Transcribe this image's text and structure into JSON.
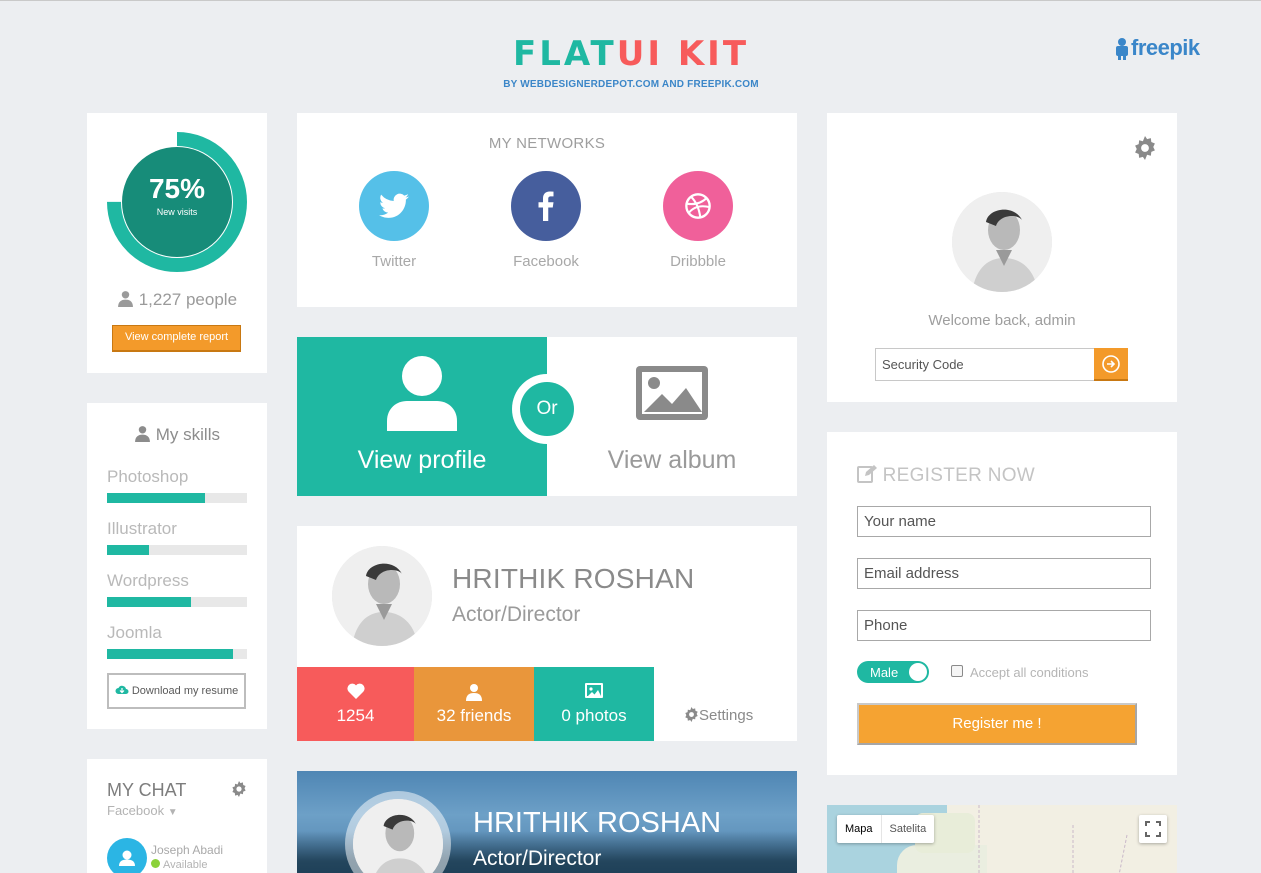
{
  "header": {
    "logo_title": "FLATUI KIT",
    "logo_subtitle": "BY WEBDESIGNERDEPOT.COM AND FREEPIK.COM",
    "freepik_label": "freepik",
    "colors": {
      "teal": "#1fb8a2",
      "red": "#f75b5b",
      "orange": "#f39a2a",
      "blue": "#3a86c9"
    }
  },
  "visits": {
    "percent_text": "75%",
    "percent_value": 75,
    "label": "New visits",
    "people": "1,227 people",
    "report_button": "View complete report"
  },
  "skills": {
    "title": "My skills",
    "items": [
      {
        "name": "Photoshop",
        "level": 0.7
      },
      {
        "name": "Illustrator",
        "level": 0.3
      },
      {
        "name": "Wordpress",
        "level": 0.6
      },
      {
        "name": "Joomla",
        "level": 0.9
      }
    ],
    "download_button": "Download my resume"
  },
  "chat": {
    "title": "MY CHAT",
    "source": "Facebook",
    "contact_name": "Joseph Abadi",
    "contact_status": "Available"
  },
  "networks": {
    "title": "MY NETWORKS",
    "items": [
      {
        "label": "Twitter",
        "icon": "twitter-icon",
        "color": "#55c0e8"
      },
      {
        "label": "Facebook",
        "icon": "facebook-icon",
        "color": "#465e9d"
      },
      {
        "label": "Dribbble",
        "icon": "dribbble-icon",
        "color": "#f0609a"
      }
    ]
  },
  "choice": {
    "profile_label": "View profile",
    "or_label": "Or",
    "album_label": "View album"
  },
  "profile": {
    "name": "HRITHIK ROSHAN",
    "role": "Actor/Director",
    "likes": "1254",
    "friends": "32 friends",
    "photos": "0 photos",
    "settings": "Settings",
    "stat_colors": [
      "#f75b5b",
      "#e9963b",
      "#1fb8a2"
    ]
  },
  "banner": {
    "name": "HRITHIK ROSHAN",
    "role": "Actor/Director"
  },
  "welcome": {
    "text": "Welcome back, admin",
    "security_placeholder": "Security Code"
  },
  "register": {
    "title": "REGISTER NOW",
    "name_placeholder": "Your name",
    "email_placeholder": "Email address",
    "phone_placeholder": "Phone",
    "gender": "Male",
    "conditions": "Accept all conditions",
    "submit": "Register me !"
  },
  "map": {
    "tab_map": "Mapa",
    "tab_satellite": "Satelita"
  }
}
